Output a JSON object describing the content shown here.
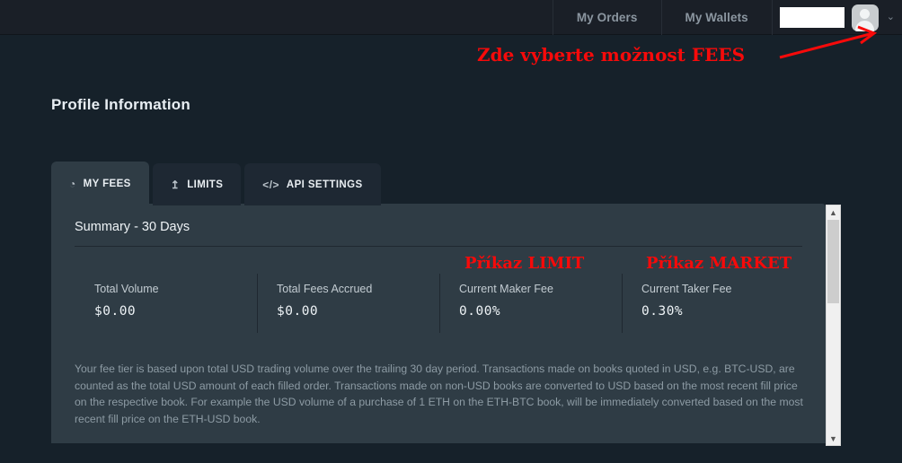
{
  "colors": {
    "page_bg": "#16212a",
    "topbar_bg": "#1a1f27",
    "card_bg": "#2f3c45",
    "tab_inactive_bg": "#1e2833",
    "annotation_red": "#f60a0a",
    "text_primary": "#eef3f6",
    "text_muted": "#8d9ba4"
  },
  "topnav": {
    "items": [
      {
        "label": "My Orders",
        "name": "nav-my-orders"
      },
      {
        "label": "My Wallets",
        "name": "nav-my-wallets"
      }
    ],
    "user": {
      "name_redacted": "",
      "avatar_icon": "user-avatar-icon",
      "chevron_icon": "chevron-down-icon",
      "chevron_glyph": "⌄"
    }
  },
  "page": {
    "title": "Profile Information"
  },
  "tabs": [
    {
      "label": "MY FEES",
      "icon": "pie-chart-icon",
      "icon_glyph": "◔",
      "active": true
    },
    {
      "label": "LIMITS",
      "icon": "upload-icon",
      "icon_glyph": "↥",
      "active": false
    },
    {
      "label": "API SETTINGS",
      "icon": "code-icon",
      "icon_glyph": "</>",
      "active": false
    }
  ],
  "fees_panel": {
    "summary_title": "Summary - 30 Days",
    "stats": [
      {
        "label": "Total Volume",
        "value": "$0.00"
      },
      {
        "label": "Total Fees Accrued",
        "value": "$0.00"
      },
      {
        "label": "Current Maker Fee",
        "value": "0.00%"
      },
      {
        "label": "Current Taker Fee",
        "value": "0.30%"
      }
    ],
    "note": "Your fee tier is based upon total USD trading volume over the trailing 30 day period. Transactions made on books quoted in USD, e.g. BTC-USD, are counted as the total USD amount of each filled order. Transactions made on non-USD books are converted to USD based on the most recent fill price on the respective book. For example the USD volume of a purchase of 1 ETH on the ETH-BTC book, will be immediately converted based on the most recent fill price on the ETH-USD book."
  },
  "scrollbar": {
    "up_arrow_glyph": "▲",
    "down_arrow_glyph": "▼"
  },
  "annotations": {
    "top": "Zde vyberte možnost FEES",
    "limit": "Příkaz LIMIT",
    "market": "Příkaz MARKET"
  }
}
